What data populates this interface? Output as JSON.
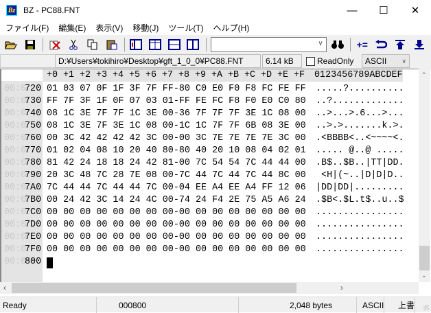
{
  "window": {
    "title": "BZ - PC88.FNT",
    "app_icon": "Bz"
  },
  "menu": [
    "ファイル(F)",
    "編集(E)",
    "表示(V)",
    "移動(J)",
    "ツール(T)",
    "ヘルプ(H)"
  ],
  "toolbar": {
    "search_value": "",
    "icons": [
      "open-folder-icon",
      "save-icon",
      "delete-icon",
      "cut-icon",
      "copy-icon",
      "paste-icon",
      "view-layout1-icon",
      "view-layout2-icon",
      "view-layout3-icon",
      "view-layout4-icon",
      "find-icon",
      "compare-icon",
      "undo-icon",
      "jump-top-icon",
      "jump-bottom-icon"
    ]
  },
  "pathbar": {
    "path": "D:¥Users¥tokihiro¥Desktop¥gft_1_0_0¥PC88.FNT",
    "size": "6.14 kB",
    "readonly_label": "ReadOnly",
    "readonly_checked": false,
    "encoding": "ASCII"
  },
  "hex": {
    "header_cols": [
      "+0",
      "+1",
      "+2",
      "+3",
      "+4",
      "+5",
      "+6",
      "+7",
      "+8",
      "+9",
      "+A",
      "+B",
      "+C",
      "+D",
      "+E",
      "+F"
    ],
    "ascii_header": "0123456789ABCDEF",
    "rows": [
      {
        "prefix": "00:0",
        "offset": "720",
        "hex": "01 03 07 0F 1F 3F 7F FF-80 C0 E0 F0 F8 FC FE FF",
        "ascii": ".....?.........."
      },
      {
        "prefix": "00:0",
        "offset": "730",
        "hex": "FF 7F 3F 1F 0F 07 03 01-FF FE FC F8 F0 E0 C0 80",
        "ascii": "..?............."
      },
      {
        "prefix": "00:0",
        "offset": "740",
        "hex": "08 1C 3E 7F 7F 1C 3E 00-36 7F 7F 7F 3E 1C 08 00",
        "ascii": "..>...>.6...>..."
      },
      {
        "prefix": "00:0",
        "offset": "750",
        "hex": "08 1C 3E 7F 3E 1C 08 00-1C 1C 7F 7F 6B 08 3E 00",
        "ascii": "..>.>.......k.>."
      },
      {
        "prefix": "00:0",
        "offset": "760",
        "hex": "00 3C 42 42 42 42 3C 00-00 3C 7E 7E 7E 7E 3C 00",
        "ascii": ".<BBBB<..<~~~~<."
      },
      {
        "prefix": "00:0",
        "offset": "770",
        "hex": "01 02 04 08 10 20 40 80-80 40 20 10 08 04 02 01",
        "ascii": "..... @..@ ....."
      },
      {
        "prefix": "00:0",
        "offset": "780",
        "hex": "81 42 24 18 18 24 42 81-00 7C 54 54 7C 44 44 00",
        "ascii": ".B$..$B..|TT|DD."
      },
      {
        "prefix": "00:0",
        "offset": "790",
        "hex": "20 3C 48 7C 28 7E 08 00-7C 44 7C 44 7C 44 8C 00",
        "ascii": " <H|(~..|D|D|D.."
      },
      {
        "prefix": "00:0",
        "offset": "7A0",
        "hex": "7C 44 44 7C 44 44 7C 00-04 EE A4 EE A4 FF 12 06",
        "ascii": "|DD|DD|........."
      },
      {
        "prefix": "00:0",
        "offset": "7B0",
        "hex": "00 24 42 3C 14 24 4C 00-74 24 F4 2E 75 A5 A6 24",
        "ascii": ".$B<.$L.t$..u..$"
      },
      {
        "prefix": "00:0",
        "offset": "7C0",
        "hex": "00 00 00 00 00 00 00 00-00 00 00 00 00 00 00 00",
        "ascii": "................"
      },
      {
        "prefix": "00:0",
        "offset": "7D0",
        "hex": "00 00 00 00 00 00 00 00-00 00 00 00 00 00 00 00",
        "ascii": "................"
      },
      {
        "prefix": "00:0",
        "offset": "7E0",
        "hex": "00 00 00 00 00 00 00 00-00 00 00 00 00 00 00 00",
        "ascii": "................"
      },
      {
        "prefix": "00:0",
        "offset": "7F0",
        "hex": "00 00 00 00 00 00 00 00-00 00 00 00 00 00 00 00",
        "ascii": "................"
      },
      {
        "prefix": "00:0",
        "offset": "800",
        "hex": "",
        "ascii": ""
      }
    ]
  },
  "status": {
    "state": "Ready",
    "position": "000800",
    "size": "2,048 bytes",
    "encoding": "ASCII",
    "mode": "上書"
  }
}
